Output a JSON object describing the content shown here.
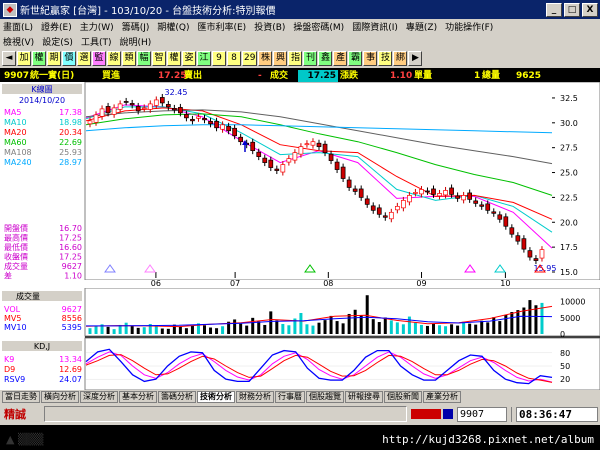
{
  "window": {
    "title": "新世紀贏家 [台灣] - 103/10/20 - 台盤技術分析:特別報價",
    "minimize": "_",
    "maximize": "□",
    "close": "X"
  },
  "menus": {
    "row1": [
      "畫面(L)",
      "證券(E)",
      "主力(W)",
      "籌碼(J)",
      "期權(Q)",
      "匯市利率(E)",
      "投資(B)",
      "操盤密碼(M)",
      "國際資訊(I)",
      "專題(Z)",
      "功能操作(F)"
    ],
    "row2": [
      "檢視(V)",
      "設定(S)",
      "工具(T)",
      "說明(H)"
    ]
  },
  "toolbar": [
    "◄",
    "加",
    "權",
    "期",
    "價",
    "選",
    "監",
    "線",
    "類",
    "幅",
    "智",
    "權",
    "姿",
    "江",
    "9",
    "8",
    "29",
    "株",
    "興",
    "指",
    "刊",
    "鑫",
    "產",
    "霸",
    "事",
    "技",
    "綁",
    "▶"
  ],
  "quote": {
    "code": "9907",
    "name": "統一實(日)",
    "buy_label": "買進",
    "buy_value": "17.25",
    "sell_label": "賣出",
    "dash": "-",
    "trade_label": "成交",
    "trade_value": "17.25",
    "change_label": "漲跌",
    "change_value": "1.10",
    "volume_label": "單量",
    "volume_value": "1",
    "total_label": "總量",
    "total_value": "9625"
  },
  "panel": {
    "kline_title": "K線圖",
    "date": "2014/10/20",
    "ma": [
      {
        "label": "MA5",
        "value": "17.38",
        "color": "#ff00ff"
      },
      {
        "label": "MA10",
        "value": "18.98",
        "color": "#00cccc"
      },
      {
        "label": "MA20",
        "value": "20.34",
        "color": "#ff0000"
      },
      {
        "label": "MA60",
        "value": "22.69",
        "color": "#00c000"
      },
      {
        "label": "MA108",
        "value": "25.93",
        "color": "#808080"
      },
      {
        "label": "MA240",
        "value": "28.97",
        "color": "#00aaff"
      }
    ],
    "ohlc": [
      {
        "label": "開盤價",
        "value": "16.70"
      },
      {
        "label": "最高價",
        "value": "17.25"
      },
      {
        "label": "最低價",
        "value": "16.60"
      },
      {
        "label": "收盤價",
        "value": "17.25"
      },
      {
        "label": "成交量",
        "value": "9627"
      },
      {
        "label": "差",
        "value": "1.10"
      }
    ],
    "volume_title": "成交量",
    "vol": [
      {
        "label": "VOL",
        "value": "9627",
        "color": "#ff00ff"
      },
      {
        "label": "MV5",
        "value": "8556",
        "color": "#ff0000"
      },
      {
        "label": "MV10",
        "value": "5395",
        "color": "#0000ff"
      }
    ],
    "kdj_title": "KD,J",
    "kdj": [
      {
        "label": "K9",
        "value": "13.34",
        "color": "#ff00ff"
      },
      {
        "label": "D9",
        "value": "12.69",
        "color": "#ff0000"
      },
      {
        "label": "RSV9",
        "value": "24.07",
        "color": "#0000ff"
      }
    ]
  },
  "chart_data": [
    {
      "type": "candlestick",
      "title": "K線圖",
      "x_ticks": [
        "06",
        "07",
        "08",
        "09",
        "10"
      ],
      "y_ticks": [
        "32.5",
        "30.0",
        "27.5",
        "25.0",
        "22.5",
        "20.0",
        "17.5",
        "15.0"
      ],
      "ylim": [
        15.0,
        33.5
      ],
      "annotations": [
        "32.45",
        "15.95"
      ],
      "closes": [
        30.2,
        30.8,
        31.4,
        31.0,
        31.5,
        31.9,
        32.1,
        31.8,
        31.2,
        31.5,
        31.9,
        32.3,
        32.0,
        31.6,
        31.3,
        31.0,
        30.5,
        30.2,
        30.6,
        30.3,
        29.9,
        29.5,
        29.8,
        29.2,
        28.7,
        28.1,
        27.8,
        27.2,
        26.6,
        26.0,
        25.5,
        25.2,
        25.8,
        26.4,
        27.0,
        27.6,
        27.9,
        28.1,
        27.6,
        27.0,
        26.2,
        25.3,
        24.4,
        23.5,
        23.1,
        22.5,
        21.8,
        21.2,
        20.8,
        20.5,
        21.0,
        21.6,
        22.2,
        22.7,
        23.0,
        23.3,
        23.1,
        22.8,
        22.9,
        23.2,
        22.8,
        22.4,
        22.7,
        22.3,
        21.9,
        21.6,
        21.2,
        20.9,
        20.3,
        19.6,
        18.8,
        18.1,
        17.3,
        16.5,
        16.15,
        17.25
      ],
      "ma_series": [
        {
          "name": "MA5",
          "values": [
            30.5,
            31.8,
            31.6,
            30.6,
            28.2,
            26.0,
            27.2,
            26.0,
            22.4,
            22.6,
            22.6,
            21.0,
            17.4
          ]
        },
        {
          "name": "MA10",
          "values": [
            30.4,
            31.6,
            31.6,
            30.9,
            29.0,
            26.8,
            27.0,
            26.6,
            23.3,
            22.2,
            22.7,
            21.6,
            19.0
          ]
        },
        {
          "name": "MA20",
          "values": [
            30.2,
            31.2,
            31.5,
            31.2,
            29.8,
            27.8,
            27.2,
            27.0,
            24.6,
            22.6,
            22.7,
            22.0,
            20.3
          ]
        },
        {
          "name": "MA60",
          "values": [
            29.8,
            30.4,
            30.8,
            30.9,
            30.6,
            29.8,
            28.9,
            28.1,
            27.0,
            25.8,
            24.8,
            24.0,
            22.7
          ]
        },
        {
          "name": "MA108",
          "values": [
            30.6,
            31.0,
            31.2,
            31.3,
            31.1,
            30.6,
            29.9,
            29.2,
            28.5,
            27.8,
            27.2,
            26.6,
            25.9
          ]
        },
        {
          "name": "MA240",
          "values": [
            29.2,
            29.5,
            29.7,
            29.8,
            29.8,
            29.7,
            29.6,
            29.5,
            29.4,
            29.3,
            29.2,
            29.1,
            29.0
          ]
        }
      ]
    },
    {
      "type": "bar",
      "title": "成交量",
      "y_ticks": [
        "10000",
        "5000",
        "0"
      ],
      "ylim": [
        0,
        13000
      ],
      "values": [
        1800,
        2500,
        3000,
        2200,
        1500,
        2800,
        3500,
        2600,
        1900,
        2100,
        3100,
        2400,
        1700,
        1600,
        2900,
        2200,
        1800,
        2500,
        3300,
        2700,
        2000,
        1800,
        2400,
        3800,
        4500,
        3200,
        2600,
        5000,
        3900,
        2800,
        7000,
        4200,
        3100,
        2700,
        4800,
        6500,
        3000,
        2600,
        3500,
        4300,
        5600,
        4000,
        3300,
        6200,
        7500,
        5800,
        12000,
        4600,
        3700,
        5100,
        4200,
        3600,
        3000,
        5400,
        3500,
        2800,
        2500,
        3100,
        2700,
        2400,
        3000,
        2600,
        3800,
        3200,
        2900,
        4100,
        3600,
        5200,
        4000,
        5900,
        6800,
        7400,
        8200,
        10500,
        8900,
        9627
      ],
      "ma_series": [
        {
          "name": "MV5",
          "values": [
            2400,
            2600,
            2500,
            2300,
            3000,
            3500,
            4500,
            4000,
            5500,
            5800,
            4200,
            3200,
            3500,
            4800,
            7000,
            8556
          ]
        },
        {
          "name": "MV10",
          "values": [
            2500,
            2500,
            2600,
            2700,
            3000,
            3300,
            3900,
            4100,
            4700,
            5200,
            4700,
            3800,
            3400,
            4000,
            5500,
            5395
          ]
        }
      ]
    },
    {
      "type": "line",
      "title": "KD,J",
      "y_ticks": [
        "80",
        "50",
        "20"
      ],
      "ylim": [
        0,
        100
      ],
      "series": [
        {
          "name": "K9",
          "values": [
            55,
            70,
            82,
            74,
            50,
            30,
            22,
            35,
            55,
            70,
            78,
            60,
            40,
            25,
            18,
            30,
            55,
            72,
            80,
            65,
            42,
            28,
            20,
            30,
            50,
            70,
            82,
            70,
            50,
            32,
            22,
            30,
            46,
            62,
            70,
            58,
            40,
            24,
            16,
            20,
            13.34
          ]
        },
        {
          "name": "D9",
          "values": [
            52,
            62,
            74,
            76,
            62,
            45,
            30,
            32,
            45,
            60,
            72,
            66,
            50,
            35,
            24,
            27,
            44,
            62,
            74,
            70,
            54,
            38,
            27,
            28,
            40,
            58,
            74,
            72,
            60,
            44,
            30,
            30,
            40,
            54,
            65,
            62,
            50,
            34,
            22,
            18,
            12.69
          ]
        },
        {
          "name": "RSV9",
          "values": [
            60,
            82,
            88,
            60,
            30,
            15,
            20,
            50,
            72,
            82,
            80,
            40,
            20,
            15,
            15,
            45,
            75,
            85,
            82,
            45,
            22,
            18,
            18,
            40,
            70,
            85,
            85,
            50,
            30,
            18,
            18,
            40,
            62,
            75,
            72,
            40,
            20,
            12,
            10,
            28,
            24.07
          ]
        }
      ]
    }
  ],
  "tabs": [
    "當日走勢",
    "橫向分析",
    "深度分析",
    "基本分析",
    "籌碼分析",
    "技術分析",
    "財務分析",
    "行事曆",
    "個股趨覽",
    "研報搜尋",
    "個股新聞",
    "產業分析"
  ],
  "active_tab": "技術分析",
  "status": {
    "mode": "精誠",
    "code": "9907",
    "time": "08:36:47"
  },
  "watermark": "http://kujd3268.pixnet.net/album"
}
